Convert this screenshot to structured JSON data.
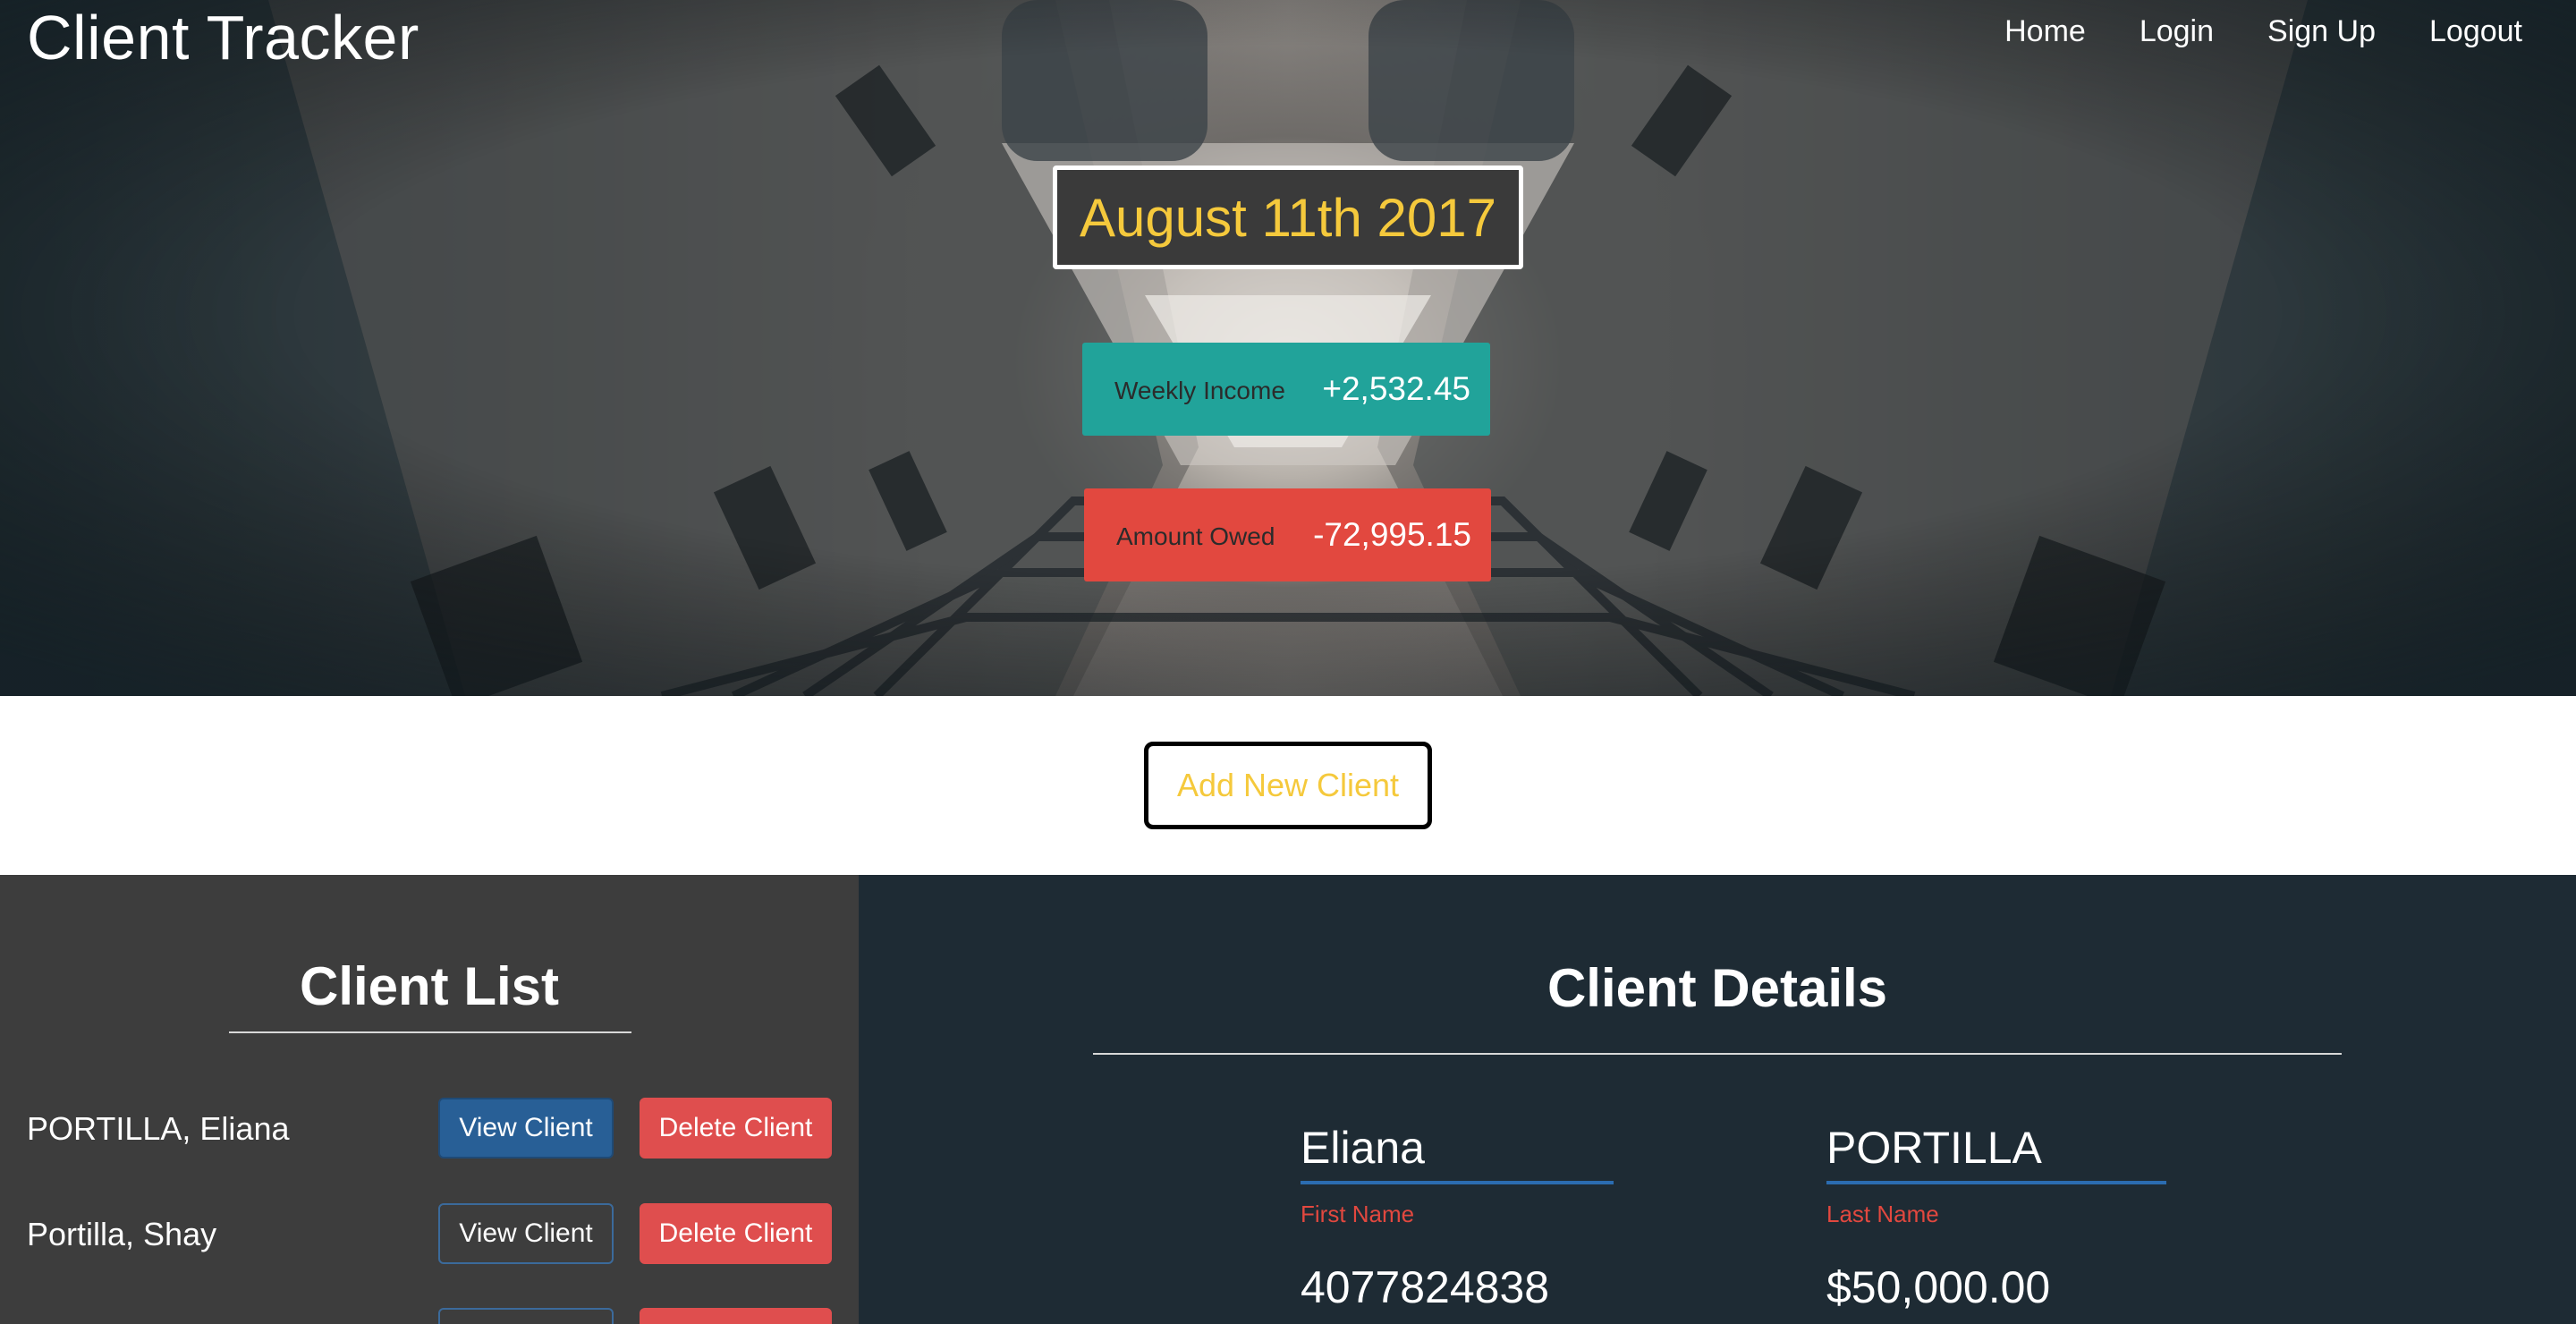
{
  "brand": "Client Tracker",
  "nav": [
    "Home",
    "Login",
    "Sign Up",
    "Logout"
  ],
  "hero": {
    "date": "August 11th 2017",
    "weekly_income": {
      "label": "Weekly Income",
      "value": "+2,532.45"
    },
    "amount_owed": {
      "label": "Amount Owed",
      "value": "-72,995.15"
    }
  },
  "add_client_label": "Add New Client",
  "client_list": {
    "title": "Client List",
    "view_label": "View Client",
    "delete_label": "Delete Client",
    "clients": [
      {
        "name": "PORTILLA, Eliana"
      },
      {
        "name": "Portilla, Shay"
      },
      {
        "name": ""
      }
    ]
  },
  "client_details": {
    "title": "Client Details",
    "first_name": {
      "value": "Eliana",
      "label": "First Name"
    },
    "last_name": {
      "value": "PORTILLA",
      "label": "Last Name"
    },
    "phone": "4077824838",
    "balance": "$50,000.00"
  },
  "colors": {
    "accent_yellow": "#f5c93c",
    "income_teal": "#21a39a",
    "owed_red": "#e2483f",
    "view_blue": "#285f96",
    "left_panel": "#3d3d3d",
    "right_panel": "#1e2b34"
  }
}
